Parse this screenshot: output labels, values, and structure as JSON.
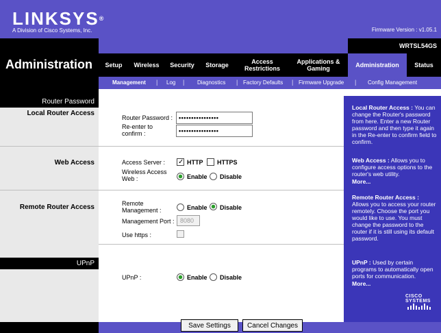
{
  "header": {
    "logo": "LINKSYS",
    "logo_mark": "®",
    "logo_sub": "A Division of Cisco Systems, Inc.",
    "firmware": "Firmware Version : v1.05.1",
    "model": "WRTSL54GS"
  },
  "page_title": "Administration",
  "nav": {
    "tabs": [
      {
        "label": "Setup"
      },
      {
        "label": "Wireless"
      },
      {
        "label": "Security"
      },
      {
        "label": "Storage"
      },
      {
        "label": "Access Restrictions"
      },
      {
        "label": "Applications & Gaming"
      },
      {
        "label": "Administration"
      },
      {
        "label": "Status"
      }
    ],
    "active_tab": "Administration"
  },
  "subnav": {
    "items": [
      "Management",
      "Log",
      "Diagnostics",
      "Factory Defaults",
      "Firmware Upgrade",
      "Config Management"
    ],
    "active": "Management"
  },
  "sections": {
    "router_password": "Router Password",
    "local_access": "Local Router Access",
    "web_access": "Web Access",
    "remote_access": "Remote Router Access",
    "upnp": "UPnP"
  },
  "form": {
    "router_password_label": "Router Password :",
    "router_password_value": "••••••••••••••••",
    "reenter_label_1": "Re-enter to",
    "reenter_label_2": "confirm :",
    "reenter_value": "••••••••••••••••",
    "access_server_label": "Access Server :",
    "http": "HTTP",
    "https": "HTTPS",
    "http_checked": true,
    "https_checked": false,
    "wireless_web_label_1": "Wireless Access",
    "wireless_web_label_2": "Web :",
    "wireless_web_value": "Enable",
    "enable": "Enable",
    "disable": "Disable",
    "remote_mgmt_label_1": "Remote",
    "remote_mgmt_label_2": "Management :",
    "remote_mgmt_value": "Disable",
    "mgmt_port_label": "Management Port :",
    "mgmt_port_value": "8080",
    "use_https_label": "Use https :",
    "use_https_checked": false,
    "upnp_label": "UPnP :",
    "upnp_value": "Enable"
  },
  "help": {
    "local_title": "Local Router Access :",
    "local_body": "You can change the Router's password from here. Enter a new Router password and then type it again in the Re-enter to confirm field to confirm.",
    "web_title": "Web Access :",
    "web_body": "Allows you to configure access options to the router's web utility.",
    "more": "More...",
    "remote_title": "Remote Router Access :",
    "remote_body": "Allows you to access your router remotely. Choose the port you would like to use. You must change the password to the router if it is still using its default password.",
    "upnp_title": "UPnP :",
    "upnp_body": "Used by certain programs to automatically open ports for communication.",
    "cisco": "CISCO SYSTEMS"
  },
  "buttons": {
    "save": "Save Settings",
    "cancel": "Cancel Changes"
  },
  "colors": {
    "brand_blue": "#5a52c6",
    "help_blue": "#3b36b8"
  }
}
